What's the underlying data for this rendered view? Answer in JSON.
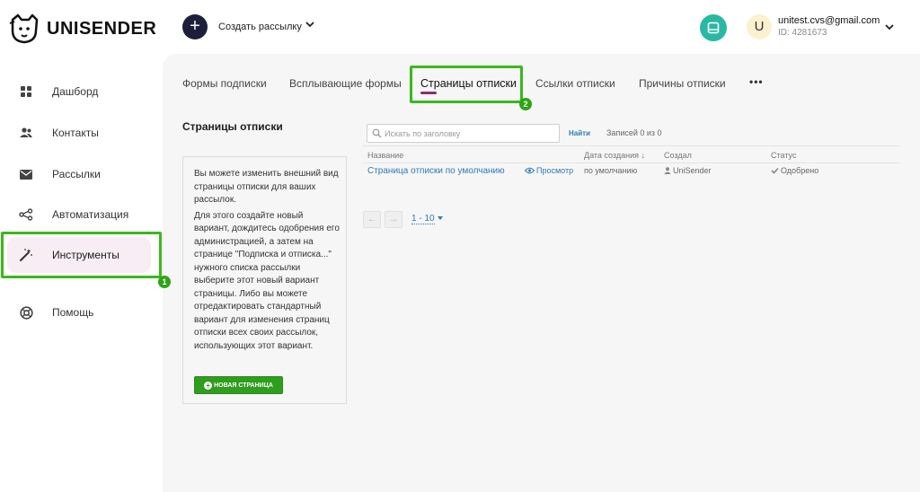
{
  "brand": {
    "name": "UNISENDER"
  },
  "header": {
    "create_label": "Создать рассылку",
    "create_icon": "plus-icon",
    "knowledge_icon": "book-icon",
    "user": {
      "avatar_letter": "U",
      "email": "unitest.cvs@gmail.com",
      "id": "ID: 4281673"
    }
  },
  "sidebar": {
    "items": [
      {
        "label": "Дашборд",
        "icon": "dashboard-icon"
      },
      {
        "label": "Контакты",
        "icon": "contacts-icon"
      },
      {
        "label": "Рассылки",
        "icon": "mail-icon"
      },
      {
        "label": "Автоматизация",
        "icon": "automation-icon"
      },
      {
        "label": "Инструменты",
        "icon": "magic-wand-icon",
        "active": true
      },
      {
        "label": "Помощь",
        "icon": "help-icon"
      }
    ]
  },
  "annotations": {
    "first": "1",
    "second": "2"
  },
  "tabs": {
    "items": [
      {
        "label": "Формы подписки"
      },
      {
        "label": "Всплывающие формы"
      },
      {
        "label": "Страницы отписки",
        "active": true
      },
      {
        "label": "Ссылки отписки"
      },
      {
        "label": "Причины отписки"
      }
    ],
    "more": "•••"
  },
  "section": {
    "title": "Страницы отписки",
    "info_paragraph_1": "Вы можете изменить внешний вид страницы отписки для ваших рассылок.",
    "info_paragraph_2": "Для этого создайте новый вариант, дождитесь одобрения его администрацией, а затем на странице \"Подписка и отписка...\" нужного списка рассылки выберите этот новый вариант страницы. Либо вы можете отредактировать стандартный вариант для изменения страниц отписки всех своих рассылок, использующих этот вариант.",
    "new_page_button": "НОВАЯ СТРАНИЦА"
  },
  "search": {
    "placeholder": "Искать по заголовку",
    "value": "",
    "find_label": "Найти",
    "records": "Записей 0 из 0"
  },
  "table": {
    "columns": [
      "Название",
      "Дата создания ↓",
      "Создал",
      "Статус"
    ],
    "rows": [
      {
        "name": "Страница отписки по умолчанию",
        "preview": "Просмотр",
        "date": "по умолчанию",
        "creator": "UniSender",
        "status": "Одобрено"
      }
    ]
  },
  "pagination": {
    "prev": "←",
    "next": "→",
    "page_size": "1 - 10"
  },
  "colors": {
    "accent": "#8a2d72",
    "highlight": "#39b91c",
    "link": "#2f79b5",
    "primary_button": "#2f9d1e",
    "teal": "#2ab8a5"
  }
}
